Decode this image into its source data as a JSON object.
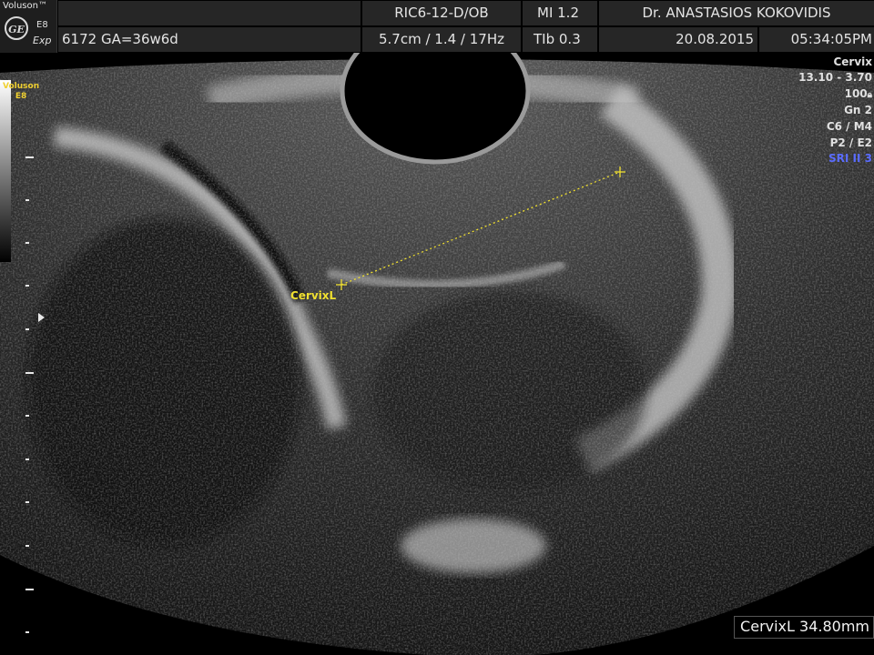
{
  "header": {
    "brand": "Voluson™",
    "logo": "GE",
    "model": "E8",
    "model_sub": "Exp",
    "probe": "RIC6-12-D/OB",
    "mi": "MI  1.2",
    "operator": "Dr. ANASTASIOS KOKOVIDIS",
    "patient": "6172  GA=36w6d",
    "depth_freq": "5.7cm / 1.4 / 17Hz",
    "tib": "TIb  0.3",
    "date": "20.08.2015",
    "time": "05:34:05PM"
  },
  "side_brand": {
    "line1": "Voluson",
    "line2": "E8"
  },
  "params": {
    "preset": "Cervix",
    "freq_range": "13.10 - 3.70",
    "power": "100",
    "gain": "Gn   2",
    "c_m": "C6 / M4",
    "p_e": "P2 / E2",
    "sri": "SRI II 3"
  },
  "caliper": {
    "label": "CervixL"
  },
  "measurement": {
    "result": "CervixL 34.80mm"
  },
  "colors": {
    "caliper": "#f0e030",
    "sri": "#5a6cff",
    "header_cell": "#262626"
  }
}
